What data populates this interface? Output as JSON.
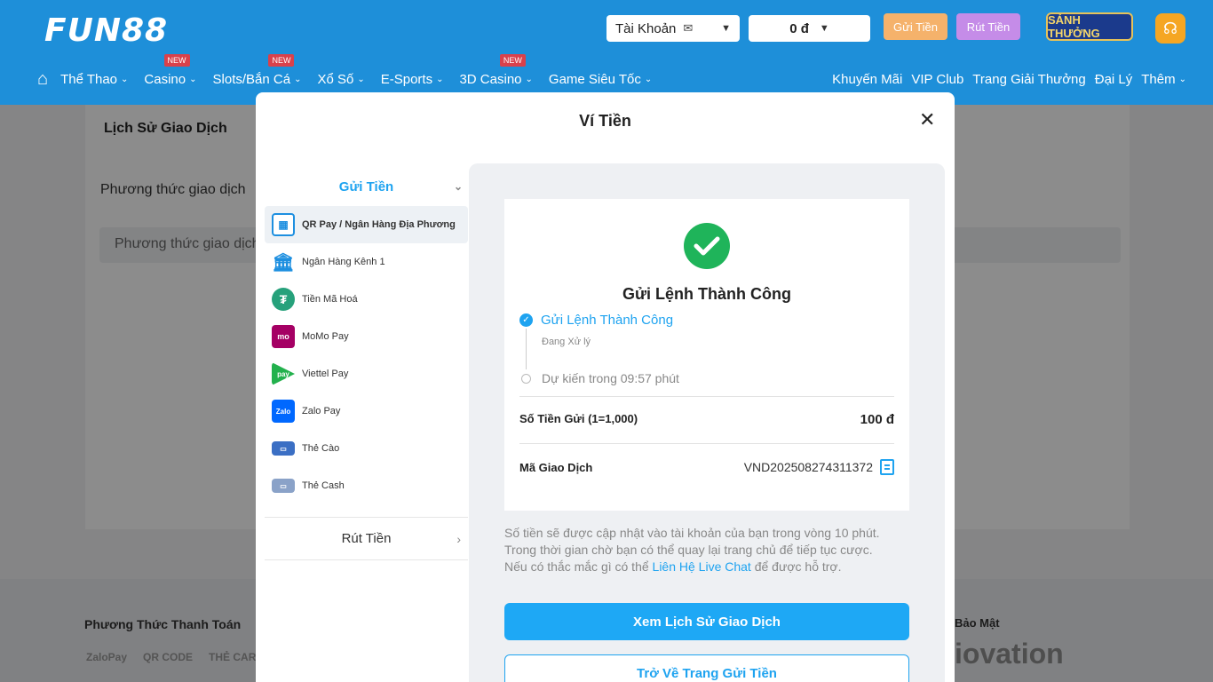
{
  "header": {
    "logo": "FUN88",
    "account_label": "Tài Khoản",
    "balance": "0 đ",
    "deposit_btn": "Gửi Tiền",
    "withdraw_btn": "Rút Tiền",
    "reward_badge": "SẢNH THƯỞNG"
  },
  "nav": {
    "left": [
      {
        "label": "Thể Thao",
        "badge": ""
      },
      {
        "label": "Casino",
        "badge": "NEW"
      },
      {
        "label": "Slots/Bắn Cá",
        "badge": "NEW"
      },
      {
        "label": "Xổ Số",
        "badge": ""
      },
      {
        "label": "E-Sports",
        "badge": ""
      },
      {
        "label": "3D Casino",
        "badge": "NEW"
      },
      {
        "label": "Game Siêu Tốc",
        "badge": ""
      }
    ],
    "right": [
      "Khuyến Mãi",
      "VIP Club",
      "Trang Giải Thưởng",
      "Đại Lý",
      "Thêm"
    ]
  },
  "background": {
    "title": "Lịch Sử Giao Dịch",
    "method_label": "Phương thức giao dịch",
    "method_placeholder": "Phương thức giao dịch",
    "footer_pay_title": "Phương Thức Thanh Toán",
    "footer_pay_logos": [
      "ZaloPay",
      "QR CODE",
      "THẺ CARD"
    ],
    "footer_security_title": "Bảo Mật",
    "footer_security_logo": "iovation"
  },
  "modal": {
    "title": "Ví Tiền",
    "side": {
      "deposit_head": "Gửi Tiền",
      "items": [
        {
          "label": "QR Pay / Ngân Hàng Địa Phương",
          "icon": "qr-icon",
          "glyph": "▦"
        },
        {
          "label": "Ngân Hàng Kênh 1",
          "icon": "bank-icon",
          "glyph": "🏛"
        },
        {
          "label": "Tiền Mã Hoá",
          "icon": "tether-icon",
          "glyph": "₮"
        },
        {
          "label": "MoMo Pay",
          "icon": "momo-icon",
          "glyph": "mo"
        },
        {
          "label": "Viettel Pay",
          "icon": "viettelpay-icon",
          "glyph": "pay"
        },
        {
          "label": "Zalo Pay",
          "icon": "zalopay-icon",
          "glyph": "Zalo"
        },
        {
          "label": "Thẻ Cào",
          "icon": "scratch-card-icon",
          "glyph": "▭"
        },
        {
          "label": "Thẻ Cash",
          "icon": "cash-card-icon",
          "glyph": "▭"
        }
      ],
      "withdraw_head": "Rút Tiền"
    },
    "result": {
      "title": "Gửi Lệnh Thành Công",
      "step1": "Gửi Lệnh Thành Công",
      "step1_sub": "Đang Xử lý",
      "step2": "Dự kiến trong 09:57 phút",
      "amount_label": "Số Tiền Gửi (1=1,000)",
      "amount_value": "100 đ",
      "txn_label": "Mã Giao Dịch",
      "txn_value": "VND202508274311372"
    },
    "note_line1": "Số tiền sẽ được cập nhật vào tài khoản của bạn trong vòng 10 phút.",
    "note_line2": "Trong thời gian chờ bạn có thể quay lại trang chủ để tiếp tục cược.",
    "note_line3_pre": "Nếu có thắc mắc gì có thể ",
    "note_link": "Liên Hệ Live Chat",
    "note_line3_post": " để được hỗ trợ.",
    "btn_history": "Xem Lịch Sử Giao Dịch",
    "btn_back": "Trở Về Trang Gửi Tiền"
  }
}
